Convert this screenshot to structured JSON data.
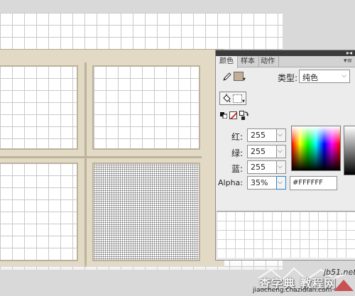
{
  "panel": {
    "tabs": [
      "颜色",
      "样本",
      "动作"
    ],
    "menu_icon": "panel-menu-icon",
    "type_label": "类型:",
    "type_value": "纯色",
    "fields": {
      "red_label": "红:",
      "red_value": "255",
      "green_label": "绿:",
      "green_value": "255",
      "blue_label": "蓝:",
      "blue_value": "255",
      "alpha_label": "Alpha:",
      "alpha_value": "35%"
    },
    "hex_value": "#FFFFFF",
    "stroke_color": "#c3ae96",
    "fill_color": "#ffffff"
  },
  "colors": {
    "frame": "#e3dac6",
    "stage": "#d9d9d9"
  },
  "watermark": {
    "site": "jb51.net",
    "text": "查字典 教程网",
    "url": "jiaocheng.chazidian.com"
  }
}
